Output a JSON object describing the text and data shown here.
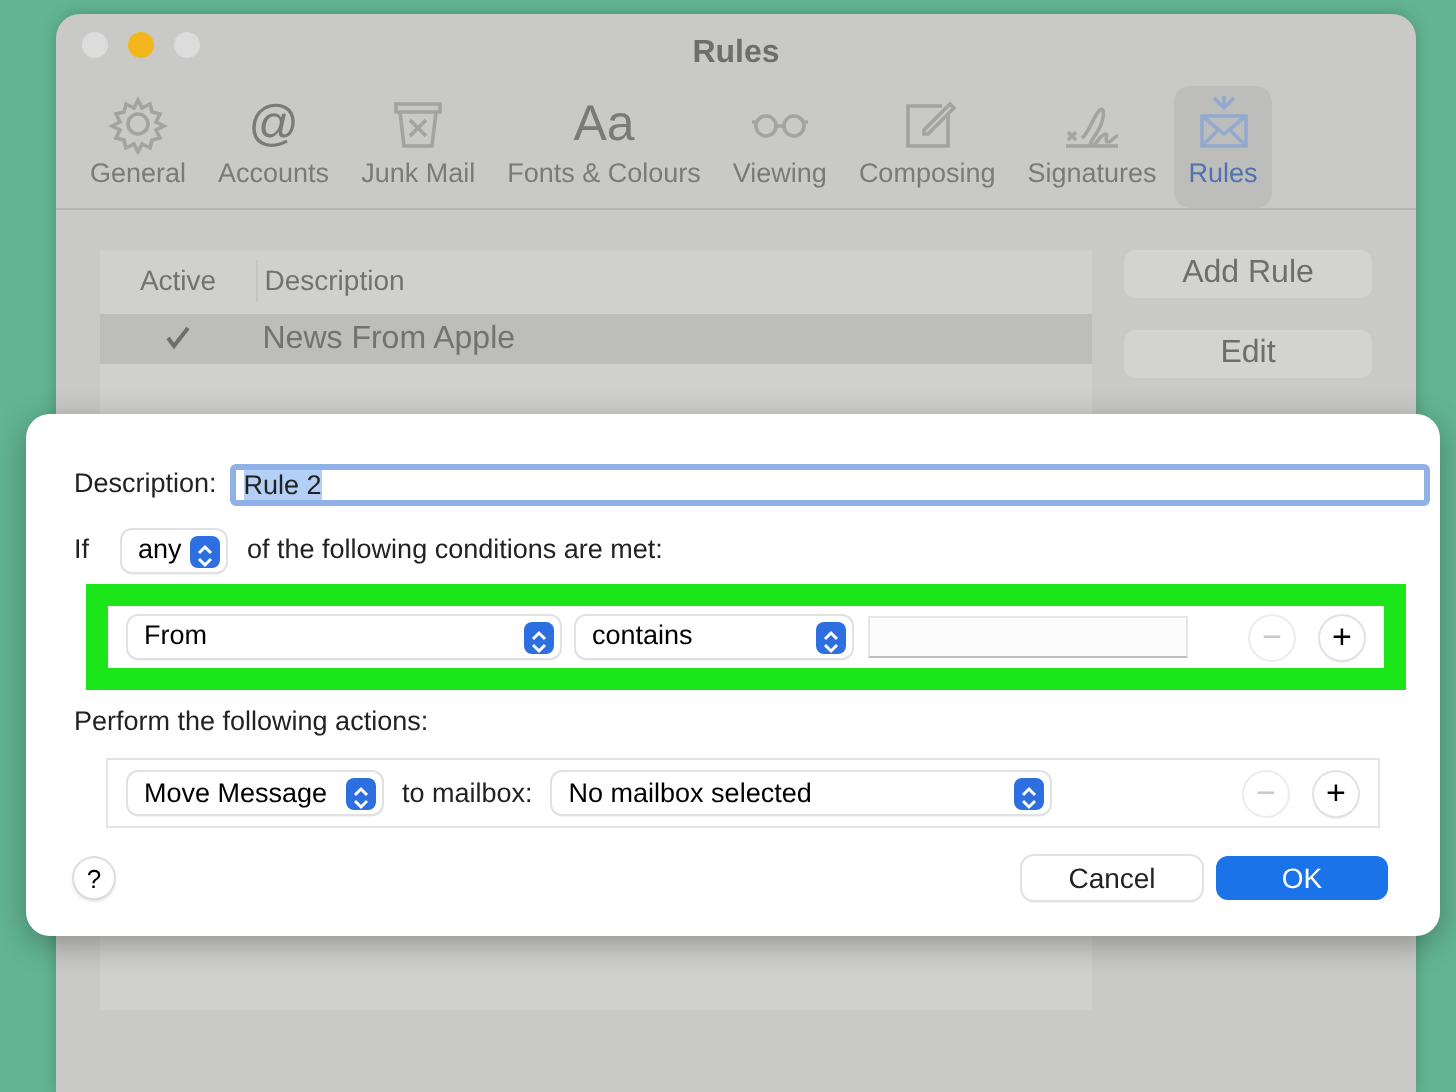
{
  "window": {
    "title": "Rules"
  },
  "toolbar": [
    {
      "label": "General",
      "selected": false
    },
    {
      "label": "Accounts",
      "glyph": "@",
      "selected": false
    },
    {
      "label": "Junk Mail",
      "selected": false
    },
    {
      "label": "Fonts & Colours",
      "glyph": "Aa",
      "selected": false
    },
    {
      "label": "Viewing",
      "selected": false
    },
    {
      "label": "Composing",
      "selected": false
    },
    {
      "label": "Signatures",
      "selected": false
    },
    {
      "label": "Rules",
      "selected": true
    }
  ],
  "rules_table": {
    "columns": [
      "Active",
      "Description"
    ],
    "rows": [
      {
        "active": true,
        "description": "News From Apple",
        "selected": true
      }
    ]
  },
  "side_buttons": [
    "Add Rule",
    "Edit"
  ],
  "sheet": {
    "description_label": "Description:",
    "description_value": "Rule 2",
    "if_label": "If",
    "match": "any",
    "conditions_text": "of the following conditions are met:",
    "conditions": [
      {
        "field": "From",
        "operator": "contains",
        "highlighted": true,
        "remove": {
          "glyph": "−",
          "disabled": true
        },
        "add": {
          "glyph": "+",
          "disabled": false
        }
      }
    ],
    "actions_label": "Perform the following actions:",
    "actions": [
      {
        "action": "Move Message",
        "target_label": "to mailbox:",
        "target": "No mailbox selected",
        "remove": {
          "glyph": "−",
          "disabled": true
        },
        "add": {
          "glyph": "+",
          "disabled": false
        }
      }
    ],
    "help": "?",
    "buttons": [
      {
        "label": "Cancel",
        "kind": "secondary"
      },
      {
        "label": "OK",
        "kind": "primary"
      }
    ]
  }
}
